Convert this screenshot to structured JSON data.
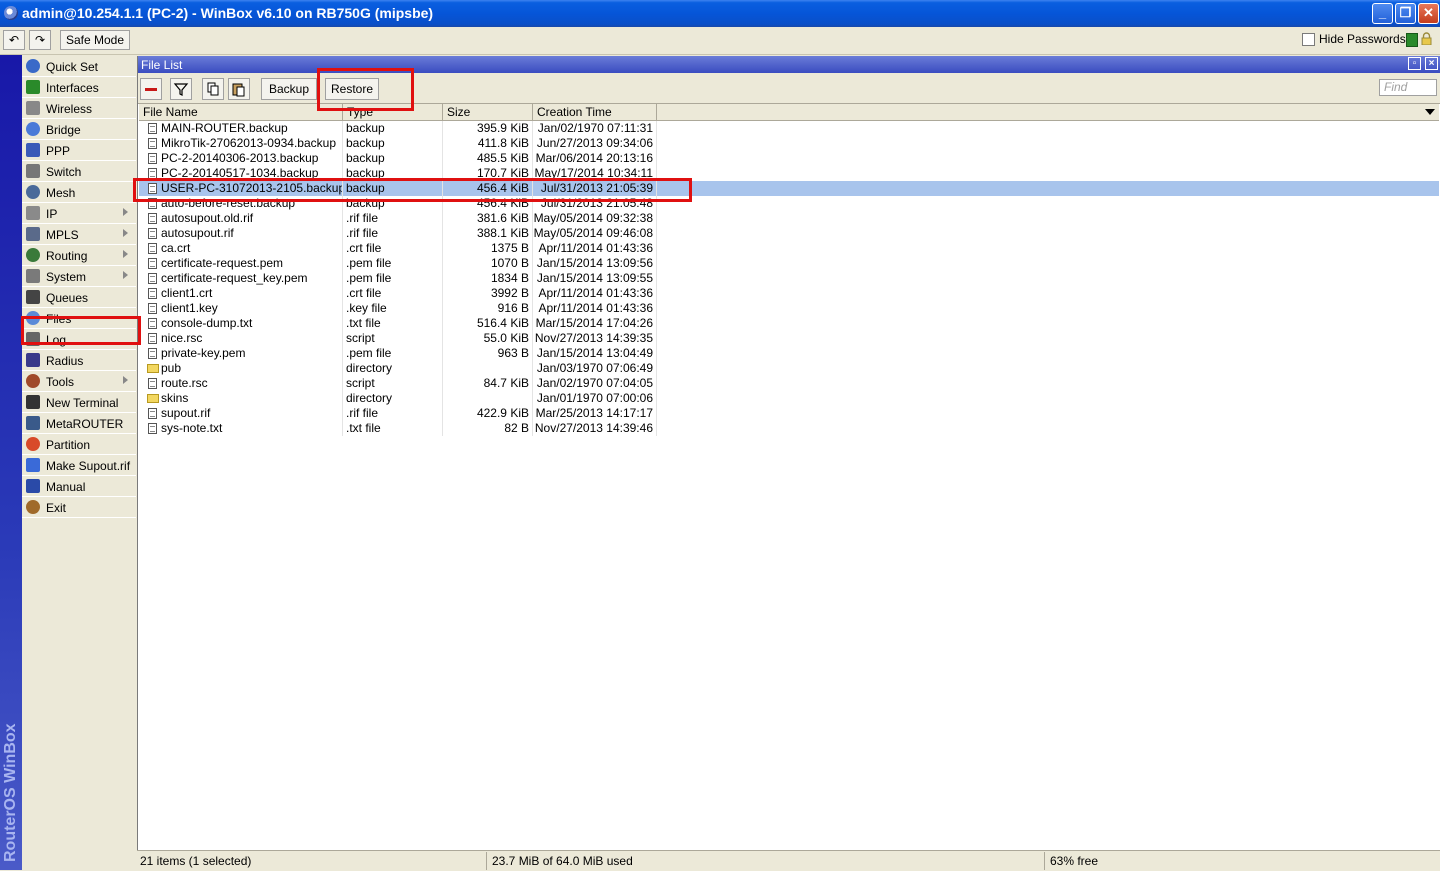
{
  "window": {
    "title": "admin@10.254.1.1 (PC-2) - WinBox v6.10 on RB750G (mipsbe)",
    "minimize": "_",
    "restore": "❐",
    "close": "✕"
  },
  "toolbar": {
    "undo": "↶",
    "redo": "↷",
    "safe_mode": "Safe Mode",
    "hide_passwords": "Hide Passwords"
  },
  "sidebar": {
    "brand": "RouterOS WinBox",
    "items": [
      {
        "label": "Quick Set",
        "icon": "quickset-icon",
        "submenu": false
      },
      {
        "label": "Interfaces",
        "icon": "interfaces-icon",
        "submenu": false
      },
      {
        "label": "Wireless",
        "icon": "wireless-icon",
        "submenu": false
      },
      {
        "label": "Bridge",
        "icon": "bridge-icon",
        "submenu": false
      },
      {
        "label": "PPP",
        "icon": "ppp-icon",
        "submenu": false
      },
      {
        "label": "Switch",
        "icon": "switch-icon",
        "submenu": false
      },
      {
        "label": "Mesh",
        "icon": "mesh-icon",
        "submenu": false
      },
      {
        "label": "IP",
        "icon": "ip-icon",
        "submenu": true
      },
      {
        "label": "MPLS",
        "icon": "mpls-icon",
        "submenu": true
      },
      {
        "label": "Routing",
        "icon": "routing-icon",
        "submenu": true
      },
      {
        "label": "System",
        "icon": "system-icon",
        "submenu": true
      },
      {
        "label": "Queues",
        "icon": "queues-icon",
        "submenu": false
      },
      {
        "label": "Files",
        "icon": "files-icon",
        "submenu": false
      },
      {
        "label": "Log",
        "icon": "log-icon",
        "submenu": false
      },
      {
        "label": "Radius",
        "icon": "radius-icon",
        "submenu": false
      },
      {
        "label": "Tools",
        "icon": "tools-icon",
        "submenu": true
      },
      {
        "label": "New Terminal",
        "icon": "terminal-icon",
        "submenu": false
      },
      {
        "label": "MetaROUTER",
        "icon": "metarouter-icon",
        "submenu": false
      },
      {
        "label": "Partition",
        "icon": "partition-icon",
        "submenu": false
      },
      {
        "label": "Make Supout.rif",
        "icon": "supout-icon",
        "submenu": false
      },
      {
        "label": "Manual",
        "icon": "manual-icon",
        "submenu": false
      },
      {
        "label": "Exit",
        "icon": "exit-icon",
        "submenu": false
      }
    ]
  },
  "file_list": {
    "title": "File List",
    "backup_label": "Backup",
    "restore_label": "Restore",
    "find_placeholder": "Find",
    "columns": [
      "File Name",
      "Type",
      "Size",
      "Creation Time"
    ],
    "rows": [
      {
        "name": "MAIN-ROUTER.backup",
        "type": "backup",
        "size": "395.9 KiB",
        "time": "Jan/02/1970 07:11:31",
        "dir": false
      },
      {
        "name": "MikroTik-27062013-0934.backup",
        "type": "backup",
        "size": "411.8 KiB",
        "time": "Jun/27/2013 09:34:06",
        "dir": false
      },
      {
        "name": "PC-2-20140306-2013.backup",
        "type": "backup",
        "size": "485.5 KiB",
        "time": "Mar/06/2014 20:13:16",
        "dir": false
      },
      {
        "name": "PC-2-20140517-1034.backup",
        "type": "backup",
        "size": "170.7 KiB",
        "time": "May/17/2014 10:34:11",
        "dir": false
      },
      {
        "name": "USER-PC-31072013-2105.backup",
        "type": "backup",
        "size": "456.4 KiB",
        "time": "Jul/31/2013 21:05:39",
        "dir": false,
        "selected": true
      },
      {
        "name": "auto-before-reset.backup",
        "type": "backup",
        "size": "456.4 KiB",
        "time": "Jul/31/2013 21:05:48",
        "dir": false
      },
      {
        "name": "autosupout.old.rif",
        "type": ".rif file",
        "size": "381.6 KiB",
        "time": "May/05/2014 09:32:38",
        "dir": false
      },
      {
        "name": "autosupout.rif",
        "type": ".rif file",
        "size": "388.1 KiB",
        "time": "May/05/2014 09:46:08",
        "dir": false
      },
      {
        "name": "ca.crt",
        "type": ".crt file",
        "size": "1375 B",
        "time": "Apr/11/2014 01:43:36",
        "dir": false
      },
      {
        "name": "certificate-request.pem",
        "type": ".pem file",
        "size": "1070 B",
        "time": "Jan/15/2014 13:09:56",
        "dir": false
      },
      {
        "name": "certificate-request_key.pem",
        "type": ".pem file",
        "size": "1834 B",
        "time": "Jan/15/2014 13:09:55",
        "dir": false
      },
      {
        "name": "client1.crt",
        "type": ".crt file",
        "size": "3992 B",
        "time": "Apr/11/2014 01:43:36",
        "dir": false
      },
      {
        "name": "client1.key",
        "type": ".key file",
        "size": "916 B",
        "time": "Apr/11/2014 01:43:36",
        "dir": false
      },
      {
        "name": "console-dump.txt",
        "type": ".txt file",
        "size": "516.4 KiB",
        "time": "Mar/15/2014 17:04:26",
        "dir": false
      },
      {
        "name": "nice.rsc",
        "type": "script",
        "size": "55.0 KiB",
        "time": "Nov/27/2013 14:39:35",
        "dir": false
      },
      {
        "name": "private-key.pem",
        "type": ".pem file",
        "size": "963 B",
        "time": "Jan/15/2014 13:04:49",
        "dir": false
      },
      {
        "name": "pub",
        "type": "directory",
        "size": "",
        "time": "Jan/03/1970 07:06:49",
        "dir": true
      },
      {
        "name": "route.rsc",
        "type": "script",
        "size": "84.7 KiB",
        "time": "Jan/02/1970 07:04:05",
        "dir": false
      },
      {
        "name": "skins",
        "type": "directory",
        "size": "",
        "time": "Jan/01/1970 07:00:06",
        "dir": true
      },
      {
        "name": "supout.rif",
        "type": ".rif file",
        "size": "422.9 KiB",
        "time": "Mar/25/2013 14:17:17",
        "dir": false
      },
      {
        "name": "sys-note.txt",
        "type": ".txt file",
        "size": "82 B",
        "time": "Nov/27/2013 14:39:46",
        "dir": false
      }
    ]
  },
  "status": {
    "items": "21 items (1 selected)",
    "usage": "23.7 MiB of 64.0 MiB used",
    "free": "63% free"
  },
  "colors": {
    "title_blue": "#0655d8",
    "selection": "#a8c4ec",
    "highlight_red": "#e01010"
  }
}
